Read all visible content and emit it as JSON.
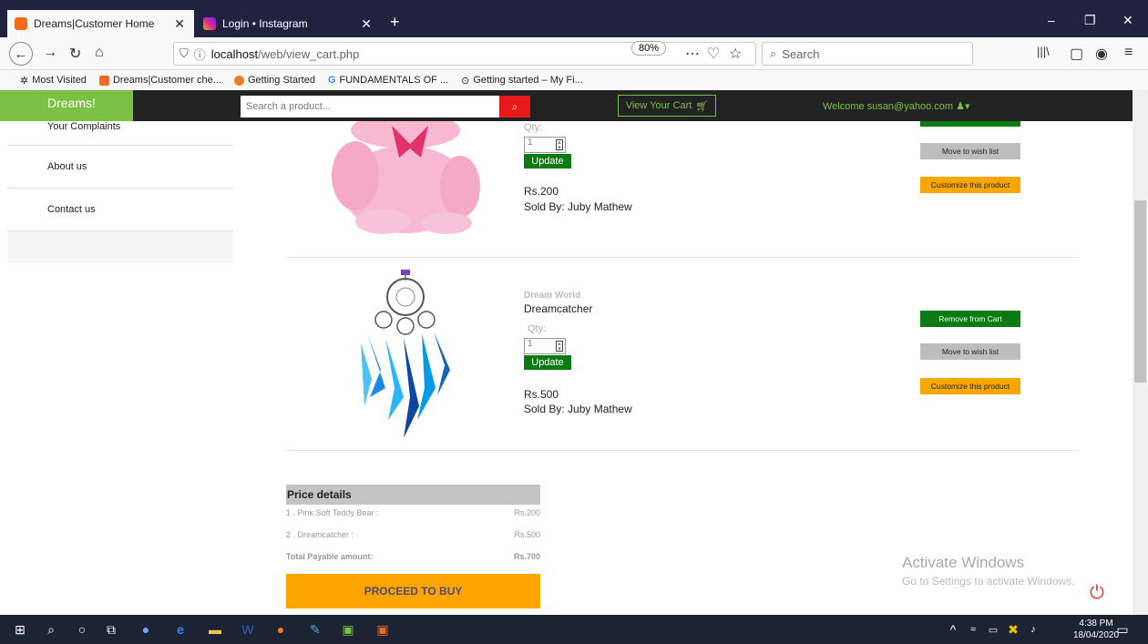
{
  "browser": {
    "tabs": [
      {
        "title": "Dreams|Customer Home",
        "active": true
      },
      {
        "title": "Login • Instagram",
        "active": false
      }
    ],
    "url_host": "localhost",
    "url_path": "/web/view_cart.php",
    "zoom": "80%",
    "search_placeholder": "Search",
    "bookmarks": [
      "Most Visited",
      "Dreams|Customer che...",
      "Getting Started",
      "FUNDAMENTALS OF ...",
      "Getting started – My Fi..."
    ]
  },
  "site": {
    "logo": "Dreams!",
    "search_placeholder": "Search a product...",
    "cart_label": "View Your Cart",
    "welcome": "Welcome  susan@yahoo.com"
  },
  "sidebar": {
    "items": [
      {
        "label": "Your Complaints"
      },
      {
        "label": "About us"
      },
      {
        "label": "Contact us"
      }
    ]
  },
  "cart": {
    "qty_label": "Qty:",
    "update_label": "Update",
    "remove_label": "Remove from Cart",
    "wish_label": "Move to wish list",
    "customize_label": "Customize this product",
    "items": [
      {
        "brand": "",
        "name": "",
        "qty": "1",
        "price": "Rs.200",
        "seller": "Sold By: Juby Mathew"
      },
      {
        "brand": "Dream World",
        "name": "Dreamcatcher",
        "qty": "1",
        "price": "Rs.500",
        "seller": "Sold By: Juby Mathew"
      }
    ]
  },
  "price_details": {
    "title": "Price details",
    "rows": [
      {
        "label": "1 . Pink Soft Teddy Bear :",
        "value": "Rs.200"
      },
      {
        "label": "2 . Dreamcatcher :",
        "value": "Rs.500"
      }
    ],
    "total_label": "Total Payable amount:",
    "total_value": "Rs.700",
    "proceed_label": "PROCEED TO BUY"
  },
  "watermark": {
    "line1": "Activate Windows",
    "line2": "Go to Settings to activate Windows."
  },
  "taskbar": {
    "time": "4:38 PM",
    "date": "18/04/2020"
  }
}
